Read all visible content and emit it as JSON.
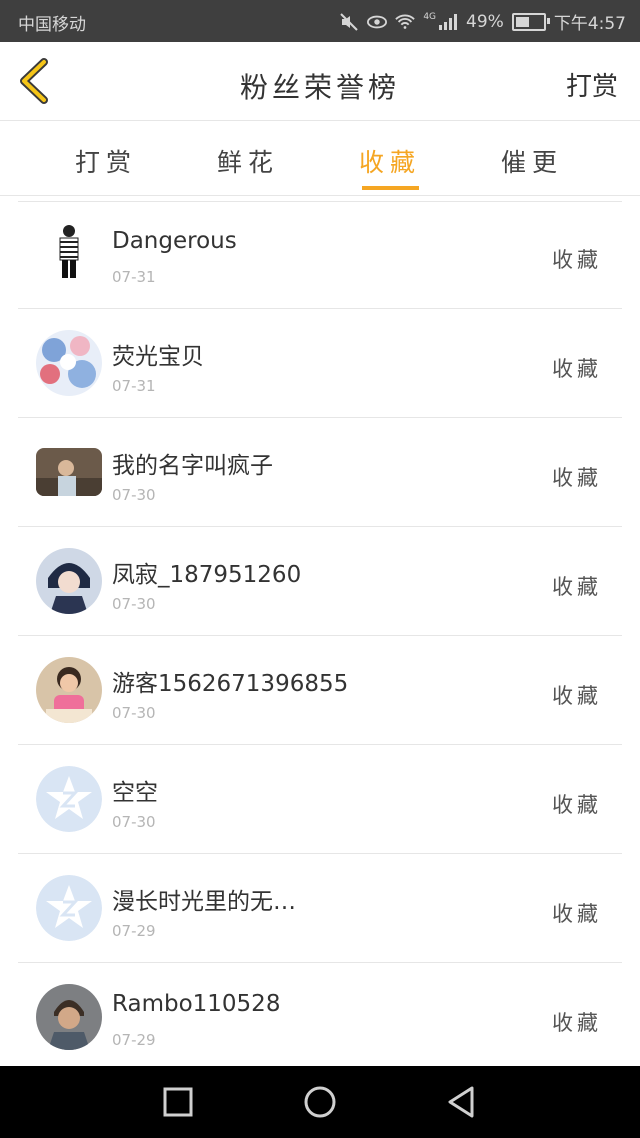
{
  "status_bar": {
    "carrier": "中国移动",
    "battery_percent": "49%",
    "time": "下午4:57",
    "network": "4G",
    "battery_level": 0.49
  },
  "header": {
    "title": "粉丝荣誉榜",
    "right_action": "打赏"
  },
  "tabs": [
    {
      "label": "打赏"
    },
    {
      "label": "鲜花"
    },
    {
      "label": "收藏",
      "active": true
    },
    {
      "label": "催更"
    }
  ],
  "list": [
    {
      "name": "Dangerous",
      "date": "07-31",
      "action": "收藏",
      "avatar": "figure-avatar"
    },
    {
      "name": "荧光宝贝",
      "date": "07-31",
      "action": "收藏",
      "avatar": "floral-avatar"
    },
    {
      "name": "我的名字叫疯子",
      "date": "07-30",
      "action": "收藏",
      "avatar": "photo-avatar"
    },
    {
      "name": "凤寂_187951260",
      "date": "07-30",
      "action": "收藏",
      "avatar": "anime-avatar"
    },
    {
      "name": "游客1562671396855",
      "date": "07-30",
      "action": "收藏",
      "avatar": "child-avatar"
    },
    {
      "name": "空空",
      "date": "07-30",
      "action": "收藏",
      "avatar": "qq-default-avatar"
    },
    {
      "name": "漫长时光里的无…",
      "date": "07-29",
      "action": "收藏",
      "avatar": "qq-default-avatar"
    },
    {
      "name": "Rambo110528",
      "date": "07-29",
      "action": "收藏",
      "avatar": "portrait-avatar"
    }
  ],
  "colors": {
    "accent": "#f5a623",
    "status_bar": "#3f3f3f",
    "divider": "#e6e6e6",
    "nav_bar": "#000000"
  },
  "nav": [
    {
      "icon": "recent-apps-icon"
    },
    {
      "icon": "home-icon"
    },
    {
      "icon": "back-icon"
    }
  ]
}
